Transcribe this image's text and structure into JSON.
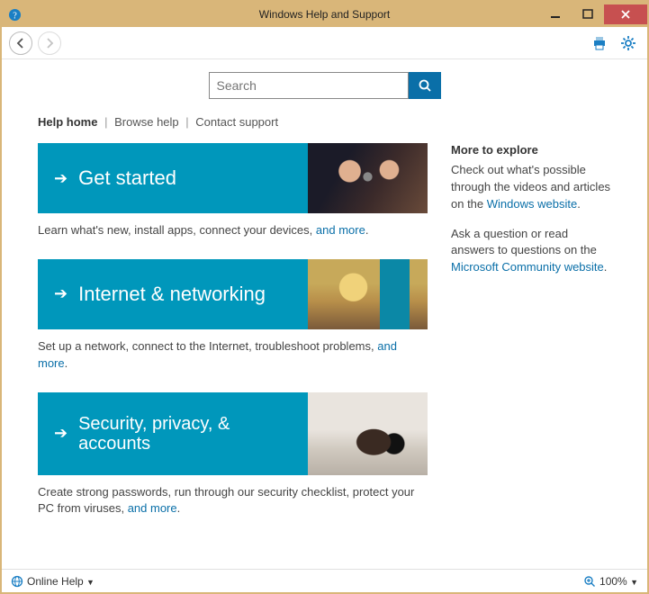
{
  "titlebar": {
    "title": "Windows Help and Support"
  },
  "toolbar": {
    "back": "Back",
    "forward": "Forward",
    "print": "Print",
    "settings": "Settings"
  },
  "search": {
    "placeholder": "Search"
  },
  "breadcrumb": {
    "home": "Help home",
    "browse": "Browse help",
    "contact": "Contact support",
    "sep": "|"
  },
  "tiles": [
    {
      "title": "Get started",
      "desc_prefix": "Learn what's new, install apps, connect your devices, ",
      "more": "and more",
      "period": "."
    },
    {
      "title": "Internet & networking",
      "desc_prefix": "Set up a network, connect to the Internet, troubleshoot problems, ",
      "more": "and more",
      "period": "."
    },
    {
      "title": "Security, privacy, & accounts",
      "desc_prefix": "Create strong passwords, run through our security checklist, protect your PC from viruses, ",
      "more": "and more",
      "period": "."
    }
  ],
  "aside": {
    "heading": "More to explore",
    "p1_a": "Check out what's possible through the videos and articles on the ",
    "p1_link": "Windows website",
    "p1_b": ".",
    "p2_a": "Ask a question or read answers to questions on the ",
    "p2_link": "Microsoft Community website",
    "p2_b": "."
  },
  "status": {
    "left": "Online Help",
    "zoom": "100%"
  }
}
